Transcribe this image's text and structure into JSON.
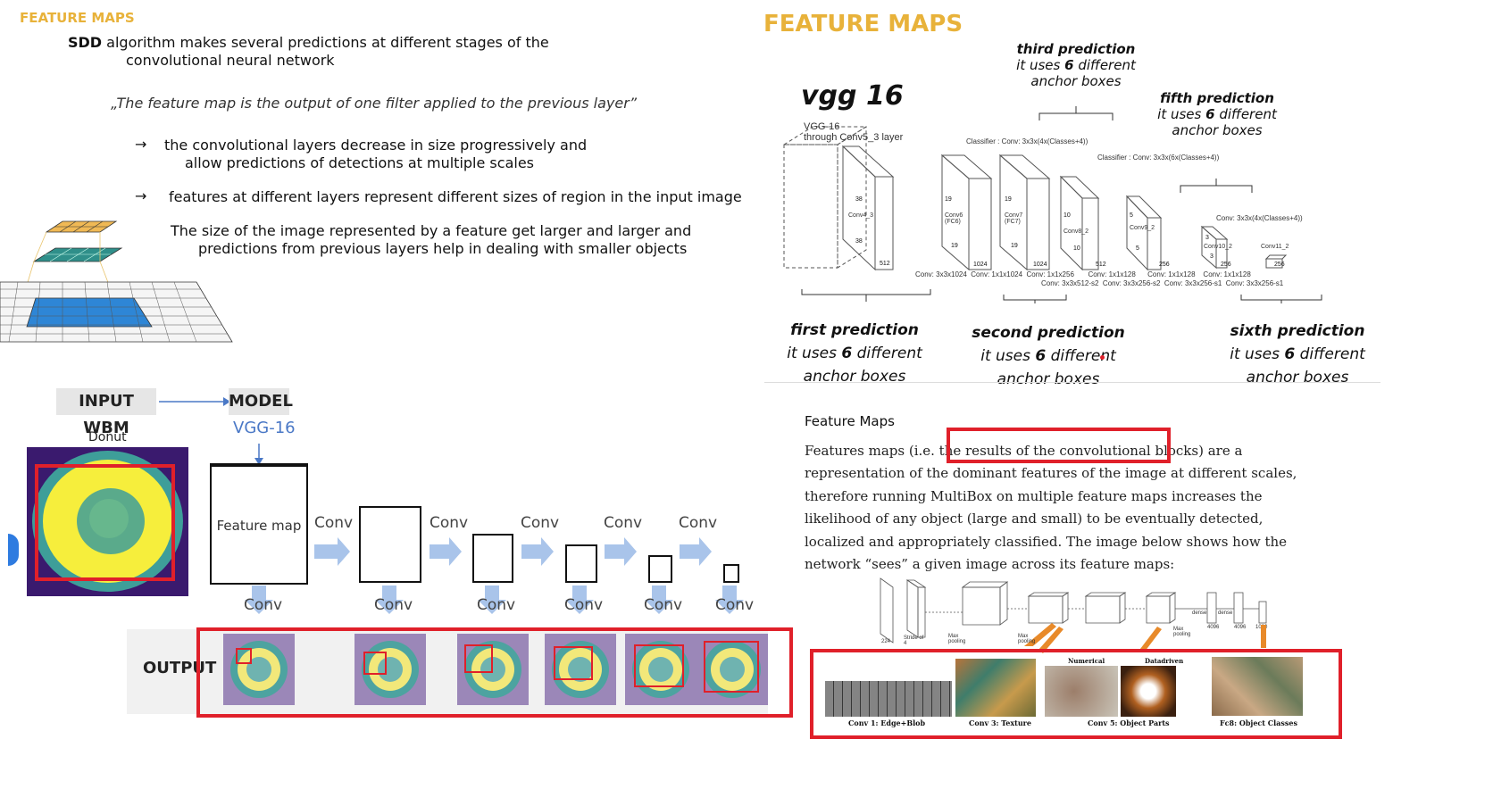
{
  "left": {
    "section_title": "FEATURE MAPS",
    "intro_bold": "SDD",
    "intro_line1": " algorithm makes several predictions at different stages of the",
    "intro_line2": "convolutional neural network",
    "quote": "„The feature map is the output of one filter applied to the previous layer”",
    "bullet1_line1": "the convolutional layers decrease in size progressively and",
    "bullet1_line2": "allow predictions of detections at multiple scales",
    "bullet2": "features at different layers represent different sizes of region in the input image",
    "para_line1": "The size of the image represented by a feature get larger and larger and",
    "para_line2": "predictions from previous layers help in dealing with smaller objects",
    "arrow_glyph": "→"
  },
  "pipeline": {
    "input_label": "INPUT WBM",
    "model_label": "MODEL",
    "vgg_label": "VGG-16",
    "donut_label": "Donut",
    "feature_map_label": "Feature map",
    "conv_label": "Conv",
    "output_label": "OUTPUT",
    "colors": {
      "purple": "#3a1a6e",
      "teal": "#3e9e99",
      "yellow": "#f6ee3c",
      "red": "#e0202a",
      "arrow": "#a9c4ea"
    }
  },
  "right_top": {
    "section_title": "FEATURE MAPS",
    "vgg_title": "vgg 16",
    "vgg_caption_1": "VGG-16",
    "vgg_caption_2": "through Conv5_3 layer",
    "classifier_1": "Classifier : Conv: 3x3x(4x(Classes+4))",
    "classifier_2": "Classifier : Conv: 3x3x(6x(Classes+4))",
    "classifier_3": "Conv: 3x3x(4x(Classes+4))",
    "conv_row_1": "Conv: 3x3x1024  Conv: 1x1x1024  Conv: 1x1x256       Conv: 1x1x128      Conv: 1x1x128    Conv: 1x1x128",
    "conv_row_2": "Conv: 3x3x512-s2  Conv: 3x3x256-s2  Conv: 3x3x256-s1  Conv: 3x3x256-s1",
    "layer_labels": [
      "Conv4_3",
      "Conv6 (FC6)",
      "Conv7 (FC7)",
      "Conv8_2",
      "Conv9_2",
      "Conv10_2",
      "Conv11_2"
    ],
    "layer_dims": [
      "38",
      "38",
      "512",
      "19",
      "19",
      "1024",
      "19",
      "19",
      "1024",
      "10",
      "10",
      "512",
      "5",
      "5",
      "256",
      "3",
      "3",
      "256",
      "256"
    ],
    "predictions": [
      {
        "title": "third prediction",
        "sub1": "it uses ",
        "num": "6",
        "sub2": " different",
        "sub3": "anchor boxes"
      },
      {
        "title": "fifth prediction",
        "sub1": "it uses ",
        "num": "6",
        "sub2": " different",
        "sub3": "anchor boxes"
      },
      {
        "title": "first prediction",
        "sub1": "it uses ",
        "num": "6",
        "sub2": " different",
        "sub3": "anchor boxes"
      },
      {
        "title": "second prediction",
        "sub1": "it uses ",
        "num": "6",
        "sub2": " different",
        "sub3": "anchor boxes"
      },
      {
        "title": "sixth prediction",
        "sub1": "it uses ",
        "num": "6",
        "sub2": " different",
        "sub3": "anchor boxes"
      }
    ]
  },
  "right_bottom": {
    "heading": "Feature Maps",
    "line1_a": "Features maps (i.e. the ",
    "line1_b": "results of the convolutional blocks",
    "line1_c": ") are a",
    "line2": "representation of the dominant features of the image at different scales,",
    "line3": "therefore running MultiBox on multiple feature maps increases the",
    "line4": "likelihood of any object (large and small) to be eventually detected,",
    "line5": "localized and appropriately classified. The image below shows how the",
    "line6": "network “sees” a given image across its feature maps:",
    "net_labels": [
      "224",
      "Stride of 4",
      "Max pooling",
      "Max pooling",
      "Max pooling",
      "dense",
      "dense",
      "4096",
      "4096",
      "1000"
    ],
    "panel_captions": [
      "Conv 1: Edge+Blob",
      "Conv 3: Texture",
      "Conv 5: Object Parts",
      "Fc8: Object Classes"
    ],
    "panel_tags": [
      "Numerical",
      "Datadriven"
    ]
  }
}
